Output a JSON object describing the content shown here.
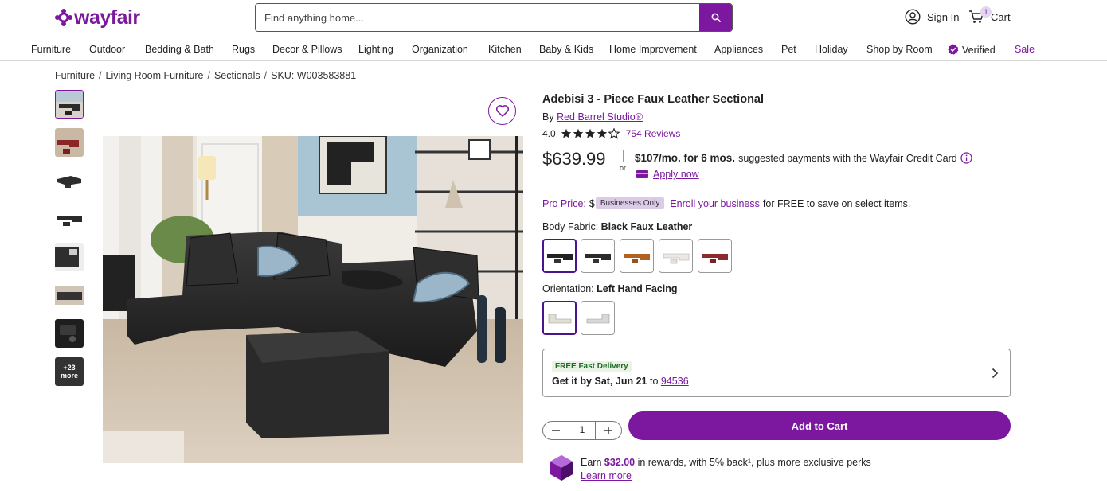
{
  "header": {
    "logo_text": "wayfair",
    "search_placeholder": "Find anything home...",
    "sign_in": "Sign In",
    "cart_label": "Cart",
    "cart_count": "1",
    "brand_color": "#7b189f"
  },
  "nav": {
    "items": [
      "Furniture",
      "Outdoor",
      "Bedding & Bath",
      "Rugs",
      "Decor & Pillows",
      "Lighting",
      "Organization",
      "Kitchen",
      "Baby & Kids",
      "Home Improvement",
      "Appliances",
      "Pet",
      "Holiday",
      "Shop by Room",
      "Verified",
      "Sale"
    ]
  },
  "breadcrumb": {
    "items": [
      "Furniture",
      "Living Room Furniture",
      "Sectionals"
    ],
    "sku": "SKU: W003583881"
  },
  "gallery": {
    "more_label": "+23 more"
  },
  "product": {
    "title": "Adebisi 3 - Piece Faux Leather Sectional",
    "by": "By",
    "brand": "Red Barrel Studio®",
    "rating": "4.0",
    "reviews": "754 Reviews",
    "price": "$639.99",
    "or": "or",
    "financing_amount": "$107/mo. for 6 mos.",
    "financing_text": "suggested payments with the Wayfair Credit Card",
    "apply_now": "Apply now",
    "pro_price_label": "Pro Price:",
    "pro_price_partial": "$",
    "businesses_only": "Businesses Only",
    "enroll_link": "Enroll your business",
    "enroll_text": "for FREE to save on select items.",
    "body_fabric_label": "Body Fabric:",
    "body_fabric_value": "Black Faux Leather",
    "orientation_label": "Orientation:",
    "orientation_value": "Left Hand Facing",
    "delivery_badge": "FREE Fast Delivery",
    "delivery_text": "Get it by Sat, Jun 21",
    "delivery_to": "to",
    "zip": "94536",
    "quantity": "1",
    "add_to_cart": "Add to Cart",
    "rewards_pre": "Earn",
    "rewards_amount": "$32.00",
    "rewards_post": "in rewards, with 5% back¹, plus more exclusive perks",
    "learn_more": "Learn more"
  }
}
